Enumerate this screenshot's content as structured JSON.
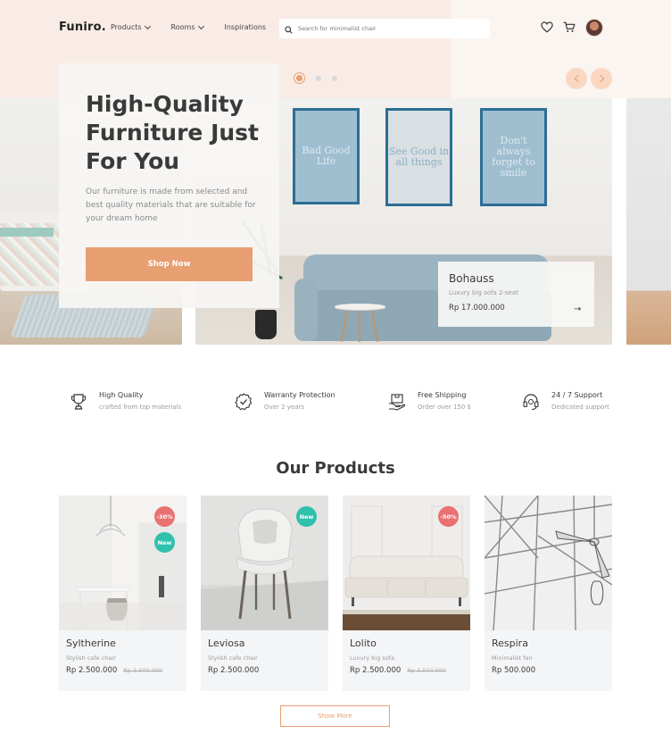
{
  "header": {
    "logo": "Funiro.",
    "nav": [
      {
        "label": "Products",
        "has_dropdown": true
      },
      {
        "label": "Rooms",
        "has_dropdown": true
      },
      {
        "label": "Inspirations",
        "has_dropdown": false
      }
    ],
    "search_placeholder": "Search for minimalist chair",
    "icons": [
      "heart-icon",
      "cart-icon",
      "avatar"
    ]
  },
  "hero": {
    "title": "High-Quality Furniture Just For You",
    "description": "Our furniture is made from selected and best quality materials that are suitable for your dream home",
    "cta": "Shop Now",
    "slides": 3,
    "active_slide": 1,
    "frames": [
      "Bad Good Life",
      "See Good in all things",
      "Don't always forget to smile"
    ],
    "featured": {
      "name": "Bohauss",
      "desc": "Luxury big sofa 2-seat",
      "price": "Rp 17.000.000"
    }
  },
  "features": [
    {
      "title": "High Quality",
      "sub": "crafted from top materials",
      "icon": "trophy-icon"
    },
    {
      "title": "Warranty Protection",
      "sub": "Over 2 years",
      "icon": "check-badge-icon"
    },
    {
      "title": "Free Shipping",
      "sub": "Order over 150 $",
      "icon": "shipping-icon"
    },
    {
      "title": "24 / 7 Support",
      "sub": "Dedicated support",
      "icon": "headset-icon"
    }
  ],
  "products": {
    "title": "Our Products",
    "items": [
      {
        "name": "Syltherine",
        "desc": "Stylish cafe chair",
        "price": "Rp 2.500.000",
        "old_price": "Rp 3.500.000",
        "badges": [
          "-30%",
          "New"
        ]
      },
      {
        "name": "Leviosa",
        "desc": "Stylish cafe chair",
        "price": "Rp 2.500.000",
        "old_price": "",
        "badges": [
          "New"
        ]
      },
      {
        "name": "Lolito",
        "desc": "Luxury big sofa",
        "price": "Rp 2.500.000",
        "old_price": "Rp 3.500.000",
        "badges": [
          "-50%"
        ]
      },
      {
        "name": "Respira",
        "desc": "Minimalist fan",
        "price": "Rp 500.000",
        "old_price": "",
        "badges": []
      }
    ],
    "show_more": "Show More"
  },
  "colors": {
    "accent": "#e89f71",
    "discount": "#e97171",
    "new": "#2ec1ac",
    "frame": "#2c6e97"
  }
}
